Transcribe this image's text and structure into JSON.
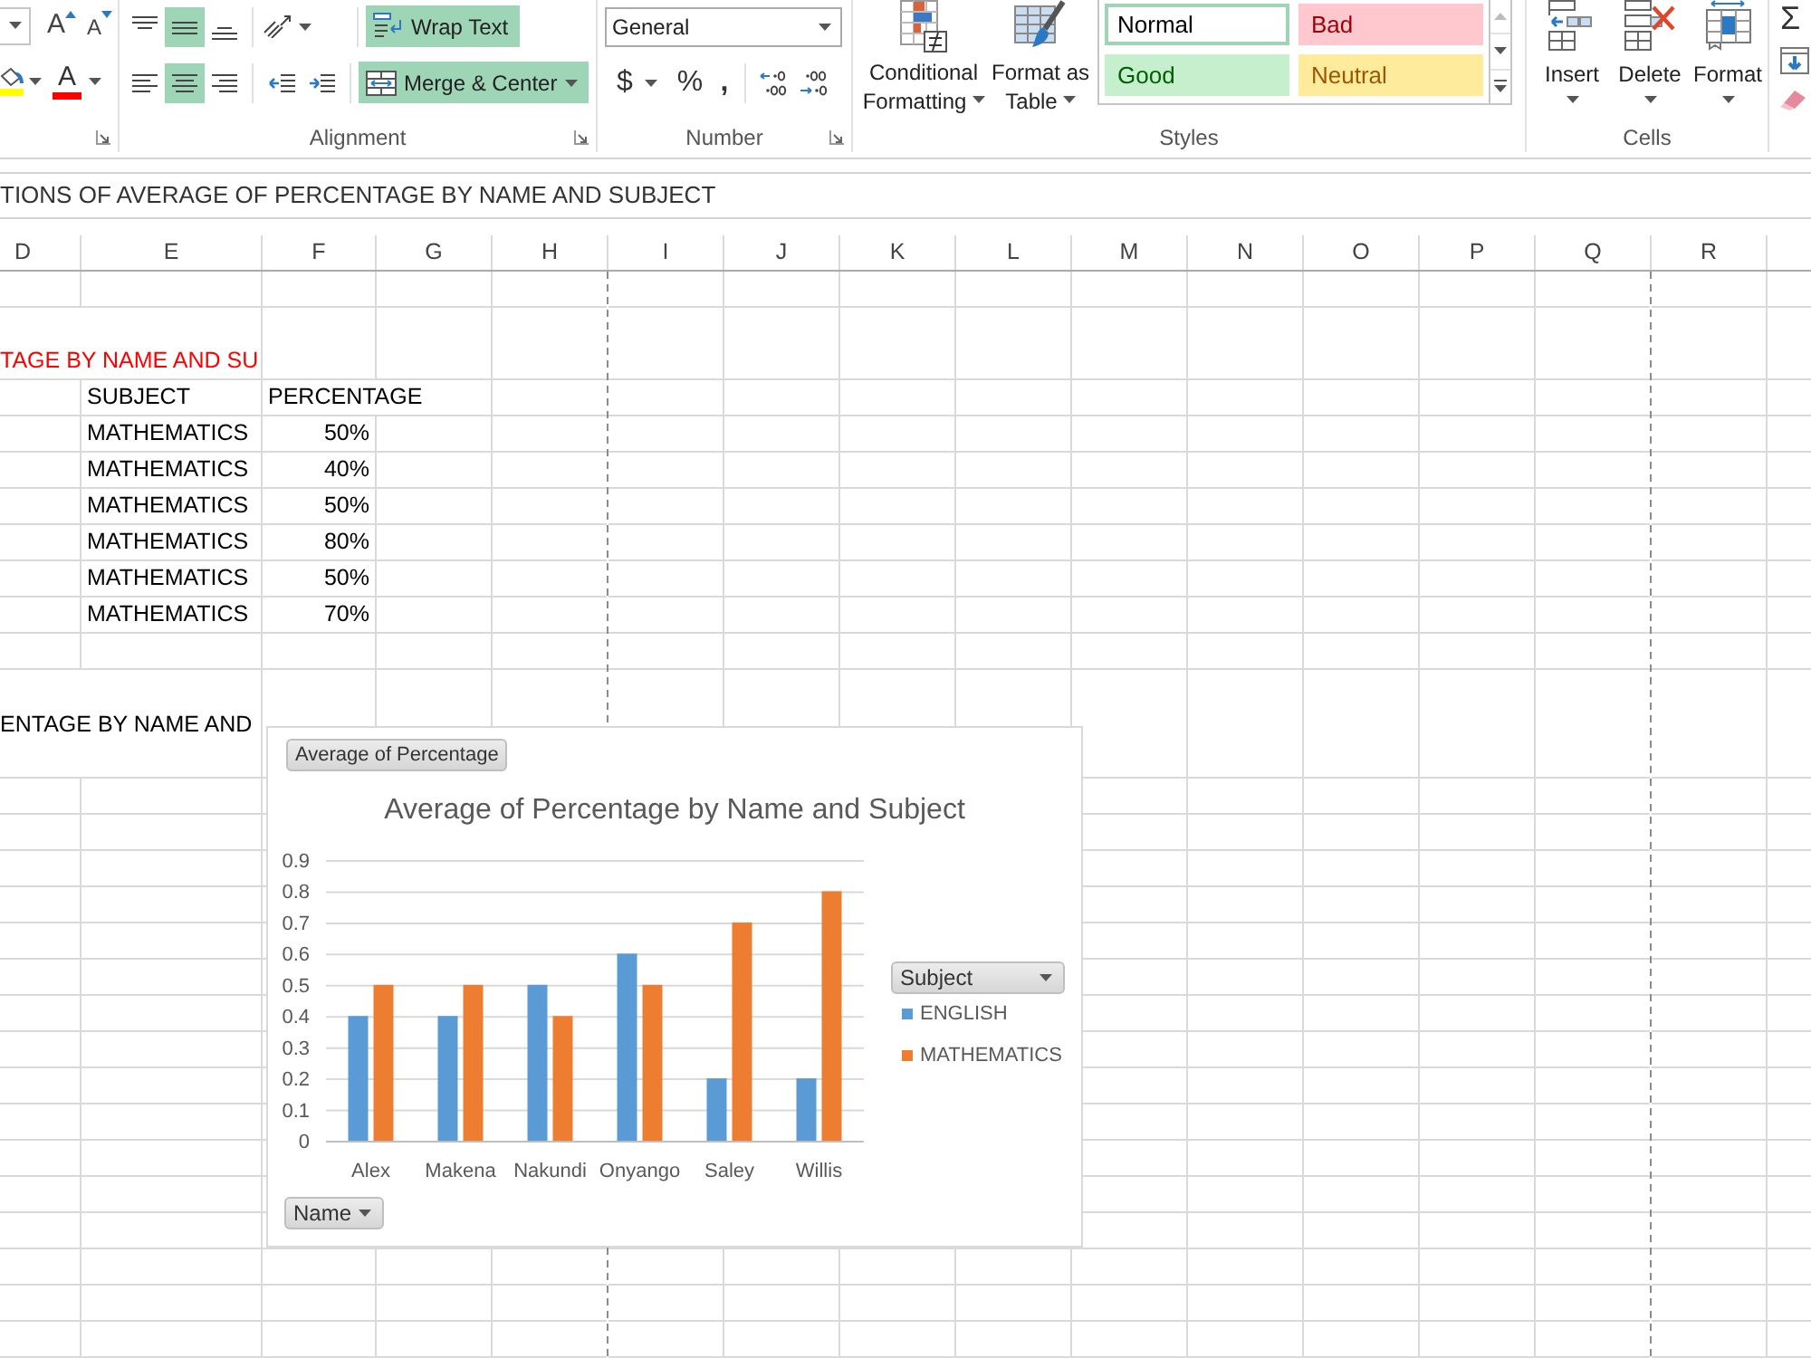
{
  "ribbon": {
    "font": {
      "grow_font_button": "A",
      "shrink_font_button": "A",
      "font_color_button": "A"
    },
    "alignment": {
      "label": "Alignment",
      "vertical_align": [
        {
          "kind": "top",
          "selected": false
        },
        {
          "kind": "middle",
          "selected": true
        },
        {
          "kind": "bottom",
          "selected": false
        }
      ],
      "horizontal_align": [
        {
          "kind": "left",
          "selected": false
        },
        {
          "kind": "center",
          "selected": true
        },
        {
          "kind": "right",
          "selected": false
        }
      ],
      "wrap_text": {
        "label": "Wrap Text",
        "on": true
      },
      "merge_and_center": {
        "label": "Merge & Center",
        "on": true
      }
    },
    "number": {
      "label": "Number",
      "format": "General",
      "currency_button": "$",
      "percent_button": "%",
      "comma_button": ","
    },
    "styles": {
      "label": "Styles",
      "conditional_formatting": [
        "Conditional",
        "Formatting"
      ],
      "format_as_table": [
        "Format as",
        "Table"
      ],
      "cell_styles": [
        {
          "kind": "normal",
          "label": "Normal",
          "selected": true
        },
        {
          "kind": "bad",
          "label": "Bad",
          "selected": false
        },
        {
          "kind": "good",
          "label": "Good",
          "selected": false
        },
        {
          "kind": "neutral",
          "label": "Neutral",
          "selected": false
        }
      ]
    },
    "cells": {
      "label": "Cells",
      "buttons": [
        {
          "kind": "insert",
          "label": "Insert"
        },
        {
          "kind": "delete",
          "label": "Delete"
        },
        {
          "kind": "format",
          "label": "Format"
        }
      ]
    },
    "editing": {
      "autosum_button": "Σ"
    }
  },
  "formula_bar": {
    "value": "TIONS OF AVERAGE OF PERCENTAGE BY NAME AND SUBJECT"
  },
  "sheet": {
    "columns": [
      {
        "label": "D",
        "page_break_before": false
      },
      {
        "label": "E",
        "page_break_before": false
      },
      {
        "label": "F",
        "page_break_before": false
      },
      {
        "label": "G",
        "page_break_before": false
      },
      {
        "label": "H",
        "page_break_before": false
      },
      {
        "label": "I",
        "page_break_before": true
      },
      {
        "label": "J",
        "page_break_before": false
      },
      {
        "label": "K",
        "page_break_before": false
      },
      {
        "label": "L",
        "page_break_before": false
      },
      {
        "label": "M",
        "page_break_before": false
      },
      {
        "label": "N",
        "page_break_before": false
      },
      {
        "label": "O",
        "page_break_before": false
      },
      {
        "label": "P",
        "page_break_before": false
      },
      {
        "label": "Q",
        "page_break_before": false
      },
      {
        "label": "R",
        "page_break_before": true
      }
    ],
    "title": "TAGE BY NAME AND SU",
    "table": {
      "headers": [
        "SUBJECT",
        "PERCENTAGE"
      ],
      "rows": [
        [
          "MATHEMATICS",
          "50%"
        ],
        [
          "MATHEMATICS",
          "40%"
        ],
        [
          "MATHEMATICS",
          "50%"
        ],
        [
          "MATHEMATICS",
          "80%"
        ],
        [
          "MATHEMATICS",
          "50%"
        ],
        [
          "MATHEMATICS",
          "70%"
        ]
      ]
    },
    "caption": "ENTAGE BY NAME AND",
    "pivot_chart": {
      "value_field_button": "Average of Percentage",
      "legend_field_button": "Subject",
      "axis_field_button": "Name",
      "chart_data": {
        "type": "bar",
        "title": "Average of Percentage by Name and Subject",
        "categories": [
          "Alex",
          "Makena",
          "Nakundi",
          "Onyango",
          "Saley",
          "Willis"
        ],
        "series": [
          {
            "name": "ENGLISH",
            "color": "#5b9bd5",
            "values": [
              0.4,
              0.4,
              0.5,
              0.6,
              0.2,
              0.2
            ]
          },
          {
            "name": "MATHEMATICS",
            "color": "#ed7d31",
            "values": [
              0.5,
              0.5,
              0.4,
              0.5,
              0.7,
              0.8
            ]
          }
        ],
        "ylim": [
          0,
          0.9
        ],
        "yticks": [
          0,
          0.1,
          0.2,
          0.3,
          0.4,
          0.5,
          0.6,
          0.7,
          0.8,
          0.9
        ],
        "grid": true
      }
    }
  }
}
